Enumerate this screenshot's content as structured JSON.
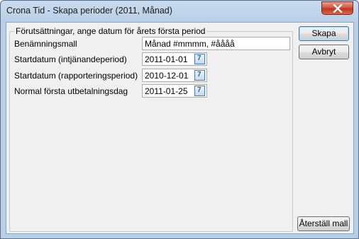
{
  "window": {
    "title": "Crona Tid - Skapa perioder (2011, Månad)"
  },
  "group": {
    "legend": "Förutsättningar, ange datum för årets första period"
  },
  "fields": {
    "naming_template": {
      "label": "Benämningsmall",
      "value": "Månad #mmmm, #åååå"
    },
    "start_earning": {
      "label": "Startdatum (intjänandeperiod)",
      "value": "2011-01-01"
    },
    "start_reporting": {
      "label": "Startdatum (rapporteringsperiod)",
      "value": "2010-12-01"
    },
    "first_payday": {
      "label": "Normal första utbetalningsdag",
      "value": "2011-01-25"
    }
  },
  "calendar_icon_glyph": "7",
  "buttons": {
    "create": "Skapa",
    "cancel": "Avbryt",
    "reset": "Återställ mall"
  },
  "colors": {
    "titlebar": "#b9cfe8",
    "close_button": "#c1351c",
    "client_background": "#f0f0f0"
  }
}
